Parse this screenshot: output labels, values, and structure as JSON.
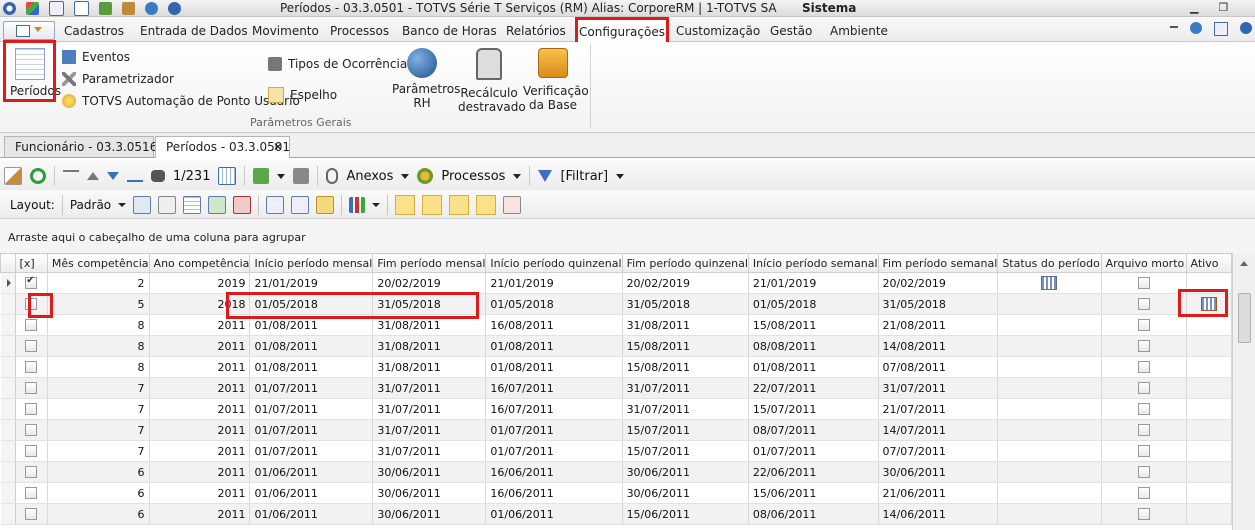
{
  "window": {
    "title": "Períodos - 03.3.0501 - TOTVS Série T Serviços (RM) Alias: CorporeRM | 1-TOTVS SA",
    "system_label": "Sistema"
  },
  "ribbon_tabs": [
    {
      "label": "Cadastros"
    },
    {
      "label": "Entrada de Dados"
    },
    {
      "label": "Movimento"
    },
    {
      "label": "Processos"
    },
    {
      "label": "Banco de Horas"
    },
    {
      "label": "Relatórios"
    },
    {
      "label": "Configurações",
      "active": true
    },
    {
      "label": "Customização"
    },
    {
      "label": "Gestão"
    },
    {
      "label": "Ambiente"
    }
  ],
  "ribbon": {
    "periodos": "Períodos",
    "eventos": "Eventos",
    "parametrizador": "Parametrizador",
    "automacao": "TOTVS Automação de Ponto Usuário",
    "tipos_ocorrencia": "Tipos de Ocorrência",
    "espelho": "Espelho",
    "parametros_rh": [
      "Parâmetros",
      "RH"
    ],
    "recalculo": [
      "Recálculo",
      "destravado"
    ],
    "verificacao": [
      "Verificação",
      "da Base"
    ],
    "group_label": "Parâmetros Gerais"
  },
  "doc_tabs": [
    {
      "label": "Funcionário - 03.3.0516"
    },
    {
      "label": "Períodos - 03.3.0501",
      "active": true
    }
  ],
  "toolbar": {
    "record_pos": "1/231",
    "anexos": "Anexos",
    "processos": "Processos",
    "filtrar": "[Filtrar]",
    "layout_label": "Layout:",
    "padrao": "Padrão"
  },
  "group_panel_text": "Arraste aqui o cabeçalho de uma coluna para agrupar",
  "columns": [
    "[x]",
    "Mês competência",
    "Ano competência",
    "Início período mensal",
    "Fim período mensal",
    "Início período quinzenal",
    "Fim período quinzenal",
    "Início período semanal",
    "Fim período semanal",
    "Status do período",
    "Arquivo morto",
    "Ativo"
  ],
  "rows": [
    {
      "checked": true,
      "mes": "2",
      "ano": "2019",
      "ini_m": "21/01/2019",
      "fim_m": "20/02/2019",
      "ini_q": "21/01/2019",
      "fim_q": "20/02/2019",
      "ini_s": "21/01/2019",
      "fim_s": "20/02/2019",
      "status_icon": true,
      "ativo_icon": false
    },
    {
      "checked": false,
      "mes": "5",
      "ano": "2018",
      "ini_m": "01/05/2018",
      "fim_m": "31/05/2018",
      "ini_q": "01/05/2018",
      "fim_q": "31/05/2018",
      "ini_s": "01/05/2018",
      "fim_s": "31/05/2018",
      "status_icon": false,
      "ativo_icon": true
    },
    {
      "checked": false,
      "mes": "8",
      "ano": "2011",
      "ini_m": "01/08/2011",
      "fim_m": "31/08/2011",
      "ini_q": "16/08/2011",
      "fim_q": "31/08/2011",
      "ini_s": "15/08/2011",
      "fim_s": "21/08/2011"
    },
    {
      "checked": false,
      "mes": "8",
      "ano": "2011",
      "ini_m": "01/08/2011",
      "fim_m": "31/08/2011",
      "ini_q": "01/08/2011",
      "fim_q": "15/08/2011",
      "ini_s": "08/08/2011",
      "fim_s": "14/08/2011"
    },
    {
      "checked": false,
      "mes": "8",
      "ano": "2011",
      "ini_m": "01/08/2011",
      "fim_m": "31/08/2011",
      "ini_q": "01/08/2011",
      "fim_q": "15/08/2011",
      "ini_s": "01/08/2011",
      "fim_s": "07/08/2011"
    },
    {
      "checked": false,
      "mes": "7",
      "ano": "2011",
      "ini_m": "01/07/2011",
      "fim_m": "31/07/2011",
      "ini_q": "16/07/2011",
      "fim_q": "31/07/2011",
      "ini_s": "22/07/2011",
      "fim_s": "31/07/2011"
    },
    {
      "checked": false,
      "mes": "7",
      "ano": "2011",
      "ini_m": "01/07/2011",
      "fim_m": "31/07/2011",
      "ini_q": "16/07/2011",
      "fim_q": "31/07/2011",
      "ini_s": "15/07/2011",
      "fim_s": "21/07/2011"
    },
    {
      "checked": false,
      "mes": "7",
      "ano": "2011",
      "ini_m": "01/07/2011",
      "fim_m": "31/07/2011",
      "ini_q": "01/07/2011",
      "fim_q": "15/07/2011",
      "ini_s": "08/07/2011",
      "fim_s": "14/07/2011"
    },
    {
      "checked": false,
      "mes": "7",
      "ano": "2011",
      "ini_m": "01/07/2011",
      "fim_m": "31/07/2011",
      "ini_q": "01/07/2011",
      "fim_q": "15/07/2011",
      "ini_s": "01/07/2011",
      "fim_s": "07/07/2011"
    },
    {
      "checked": false,
      "mes": "6",
      "ano": "2011",
      "ini_m": "01/06/2011",
      "fim_m": "30/06/2011",
      "ini_q": "16/06/2011",
      "fim_q": "30/06/2011",
      "ini_s": "22/06/2011",
      "fim_s": "30/06/2011"
    },
    {
      "checked": false,
      "mes": "6",
      "ano": "2011",
      "ini_m": "01/06/2011",
      "fim_m": "30/06/2011",
      "ini_q": "16/06/2011",
      "fim_q": "30/06/2011",
      "ini_s": "15/06/2011",
      "fim_s": "21/06/2011"
    },
    {
      "checked": false,
      "mes": "6",
      "ano": "2011",
      "ini_m": "01/06/2011",
      "fim_m": "30/06/2011",
      "ini_q": "01/06/2011",
      "fim_q": "15/06/2011",
      "ini_s": "08/06/2011",
      "fim_s": "14/06/2011"
    }
  ],
  "colors": {
    "highlight": "#e0191b",
    "accent": "#fbe28a"
  }
}
